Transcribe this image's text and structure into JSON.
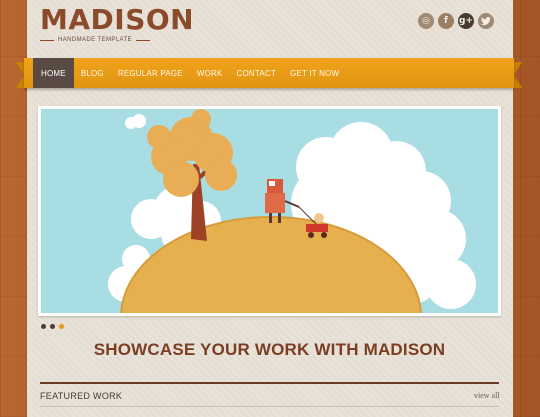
{
  "header": {
    "logo_title": "MADISON",
    "logo_subtitle": "HANDMADE TEMPLATE",
    "social": [
      {
        "icon": "dribbble-icon",
        "glyph": "◎"
      },
      {
        "icon": "facebook-icon",
        "glyph": "f"
      },
      {
        "icon": "google-plus-icon",
        "glyph": "g+"
      },
      {
        "icon": "twitter-icon",
        "glyph": "🐦"
      }
    ]
  },
  "nav": {
    "items": [
      "HOME",
      "BLOG",
      "REGULAR PAGE",
      "WORK",
      "CONTACT",
      "GET IT NOW"
    ],
    "active": "HOME"
  },
  "slider": {
    "slide_count": 3,
    "active_index": 2
  },
  "showcase_heading": "SHOWCASE YOUR WORK WITH MADISON",
  "featured": {
    "title": "FEATURED WORK",
    "view_all": "view all"
  },
  "colors": {
    "accent": "#e39b17",
    "brand_brown": "#7b3e22",
    "nav_active": "#5a4a44"
  }
}
